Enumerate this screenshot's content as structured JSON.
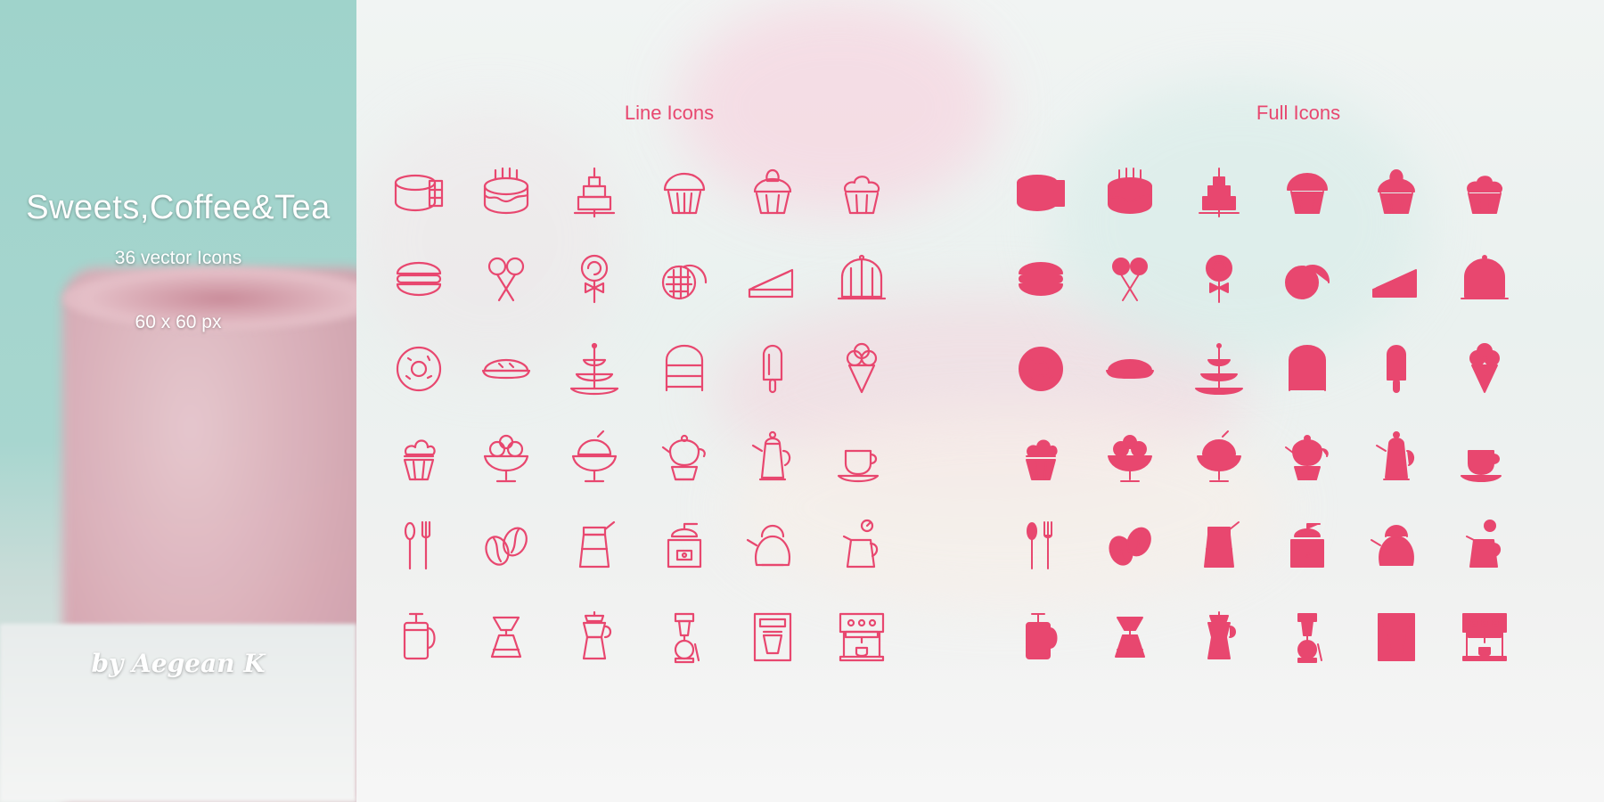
{
  "cover": {
    "title": "Sweets,Coffee&Tea",
    "count_label": "36 vector Icons",
    "size_label": "60 x 60 px",
    "author": "by Aegean K"
  },
  "sections": {
    "line_title": "Line Icons",
    "full_title": "Full Icons"
  },
  "colors": {
    "accent": "#e8476f",
    "panel_teal": "#a3d5ce"
  },
  "icons": [
    "layer-cake-slice-icon",
    "birthday-cake-icon",
    "tiered-cake-icon",
    "muffin-icon",
    "strawberry-cupcake-icon",
    "cupcake-icon",
    "macaron-icon",
    "cake-pops-icon",
    "lollipop-icon",
    "waffle-icon",
    "pie-slice-icon",
    "jelly-mold-icon",
    "donut-icon",
    "pie-icon",
    "cake-stand-icon",
    "cupcake-carrier-icon",
    "popsicle-icon",
    "ice-cream-cone-icon",
    "cupcake-cone-icon",
    "sundae-icon",
    "shaved-ice-icon",
    "teapot-warmer-icon",
    "coffee-pot-icon",
    "tea-cup-icon",
    "spoon-fork-icon",
    "coffee-beans-icon",
    "chemex-grinder-icon",
    "coffee-grinder-icon",
    "kettle-icon",
    "milk-pitcher-icon",
    "french-press-icon",
    "pour-over-icon",
    "moka-pot-icon",
    "siphon-icon",
    "drip-coffee-maker-icon",
    "espresso-machine-icon"
  ]
}
